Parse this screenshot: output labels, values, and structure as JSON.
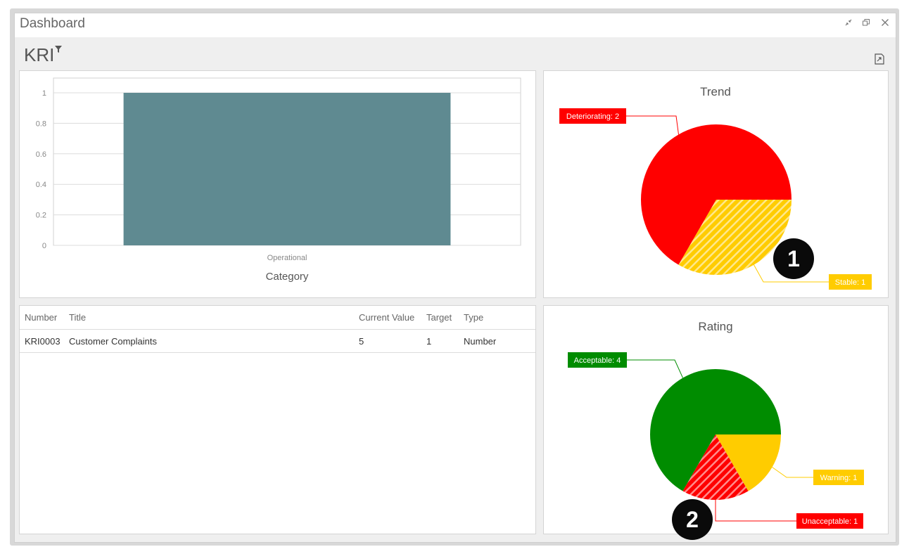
{
  "window": {
    "title": "Dashboard",
    "controls": [
      "collapse-icon",
      "restore-icon",
      "close-icon"
    ]
  },
  "dashboard": {
    "title": "KRI",
    "filter_icon": "filter-icon",
    "export_icon": "export-icon"
  },
  "bar_chart": {
    "chart_data": {
      "type": "bar",
      "categories": [
        "Operational"
      ],
      "values": [
        1
      ],
      "xlabel": "Category",
      "ylabel": "",
      "ylim": [
        0,
        1
      ],
      "yticks": [
        "0",
        "0.2",
        "0.4",
        "0.6",
        "0.8",
        "1"
      ],
      "bar_color": "#5f8a91",
      "grid": true
    }
  },
  "trend_chart": {
    "chart_data": {
      "type": "pie",
      "title": "Trend",
      "slices": [
        {
          "label": "Deteriorating: 2",
          "value": 2,
          "color": "#ff0000"
        },
        {
          "label": "Stable: 1",
          "value": 1,
          "color": "#ffcc00",
          "hatched": true
        }
      ]
    }
  },
  "rating_chart": {
    "chart_data": {
      "type": "pie",
      "title": "Rating",
      "slices": [
        {
          "label": "Acceptable: 4",
          "value": 4,
          "color": "#008c00"
        },
        {
          "label": "Warning: 1",
          "value": 1,
          "color": "#ffcc00"
        },
        {
          "label": "Unacceptable: 1",
          "value": 1,
          "color": "#ff0000",
          "hatched": true
        }
      ]
    }
  },
  "table": {
    "columns": [
      "Number",
      "Title",
      "Current Value",
      "Target",
      "Type"
    ],
    "rows": [
      [
        "KRI0003",
        "Customer Complaints",
        "5",
        "1",
        "Number"
      ]
    ]
  },
  "callouts": [
    "1",
    "2"
  ]
}
